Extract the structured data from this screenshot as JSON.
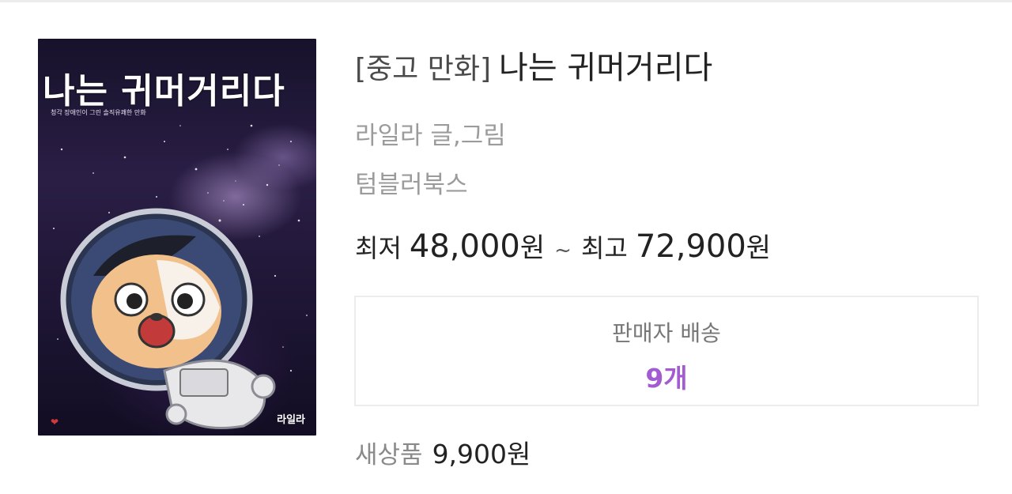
{
  "book": {
    "cover": {
      "title": "나는 귀머거리다",
      "subtitle": "청각 장애인이 그린 솔직유쾌한 만화",
      "author": "라일라",
      "publisher_mark": "tumbler-books-logo"
    },
    "title_prefix": "[중고 만화]",
    "title": "나는 귀머거리다",
    "author_line": "라일라 글,그림",
    "publisher": "텀블러북스"
  },
  "price": {
    "min_label": "최저",
    "min_value": "48,000",
    "separator": "~",
    "max_label": "최고",
    "max_value": "72,900",
    "currency": "원"
  },
  "seller": {
    "label": "판매자 배송",
    "count": "9개"
  },
  "new_price": {
    "label": "새상품",
    "value": "9,900원"
  },
  "colors": {
    "accent": "#a35bd1",
    "text_dark": "#222222",
    "text_muted": "#9b9b9b",
    "border": "#ececec"
  }
}
